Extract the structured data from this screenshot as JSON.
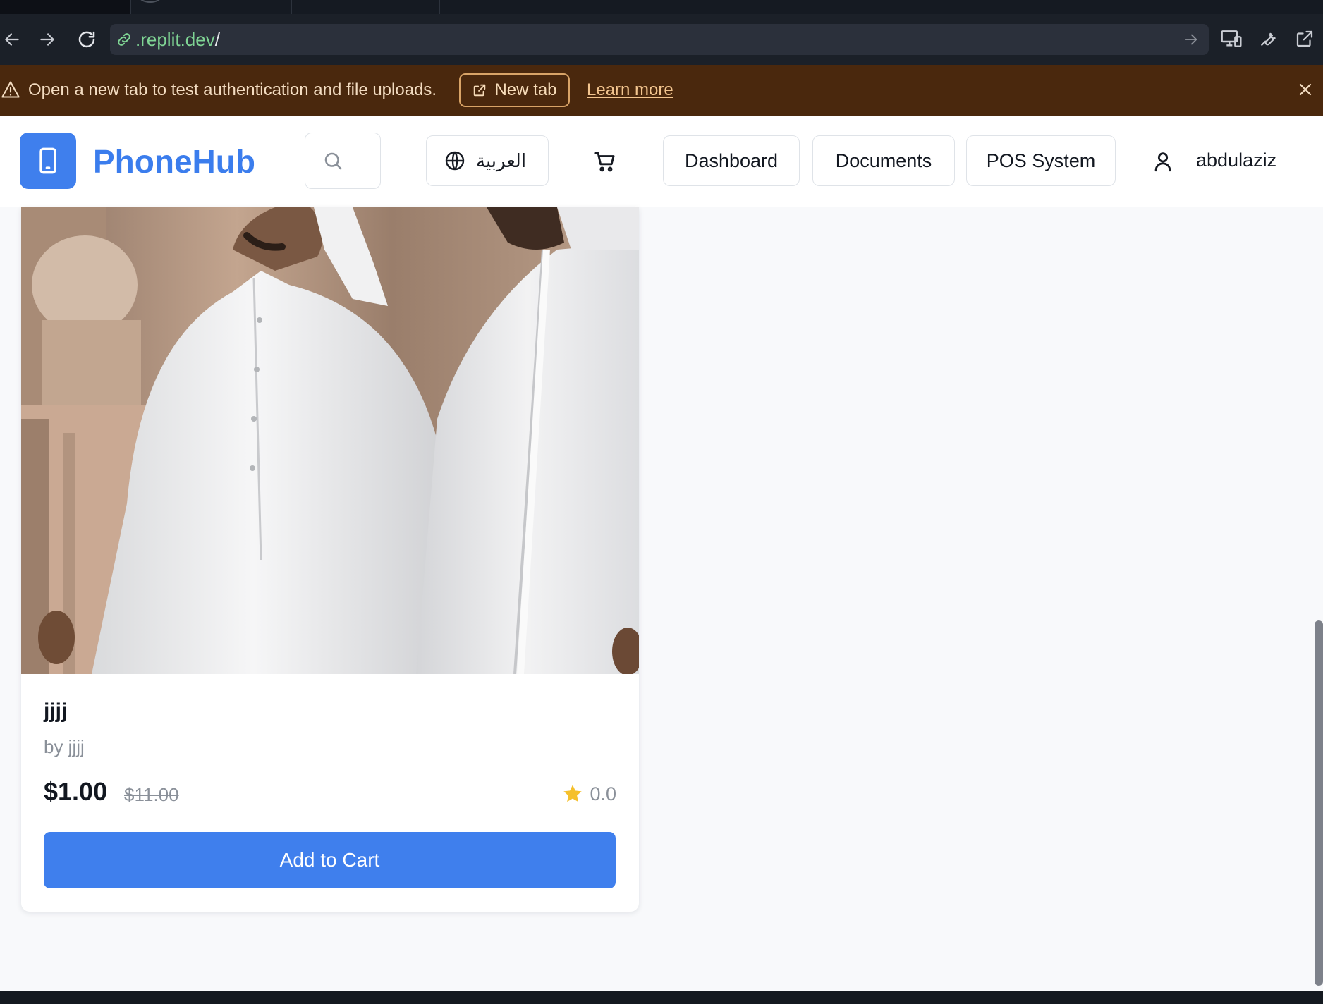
{
  "browser": {
    "url_host": ".replit.dev",
    "url_path": "/"
  },
  "banner": {
    "message": "Open a new tab to test authentication and file uploads.",
    "new_tab_label": "New tab",
    "learn_more_label": "Learn more"
  },
  "header": {
    "brand": "PhoneHub",
    "language_label": "العربية",
    "nav": [
      "Dashboard",
      "Documents",
      "POS System"
    ],
    "user": "abdulaziz"
  },
  "product": {
    "title": "jjjj",
    "brand": "by jjjj",
    "price": "$1.00",
    "old_price": "$11.00",
    "rating": "0.0",
    "add_to_cart": "Add to Cart"
  },
  "colors": {
    "accent": "#3f7fed",
    "banner_bg": "#4a280d",
    "star": "#f5c02c"
  }
}
